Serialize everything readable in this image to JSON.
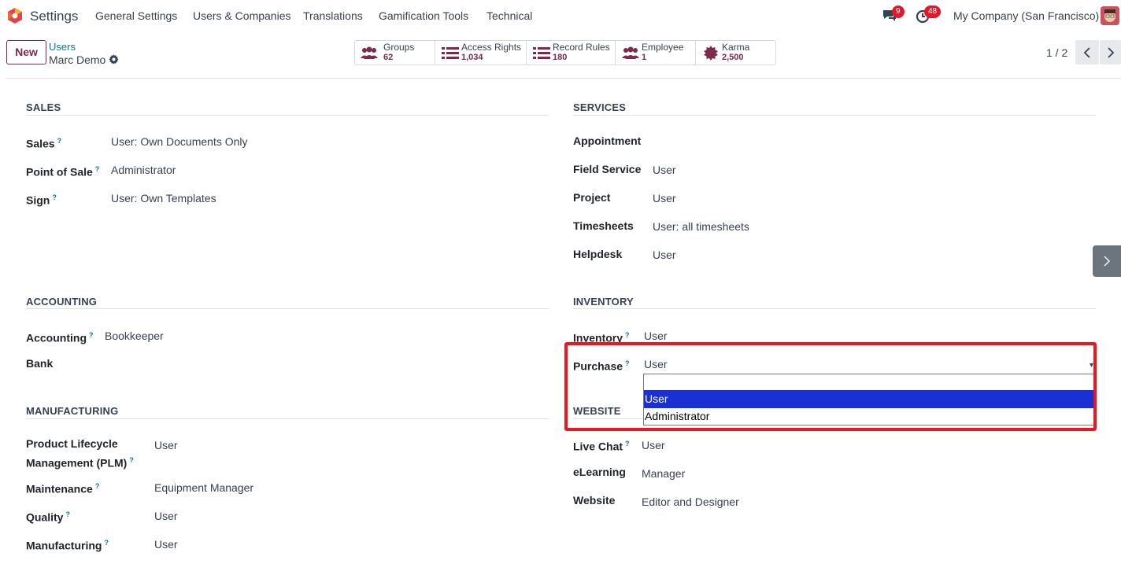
{
  "navbar": {
    "app_name": "Settings",
    "menus": [
      "General Settings",
      "Users & Companies",
      "Translations",
      "Gamification Tools",
      "Technical"
    ],
    "messages_badge": "9",
    "activities_badge": "48",
    "company": "My Company (San Francisco)"
  },
  "control": {
    "new_label": "New",
    "breadcrumb_parent": "Users",
    "breadcrumb_current": "Marc Demo",
    "pager": "1 / 2"
  },
  "smart_buttons": [
    {
      "label": "Groups",
      "value": "62",
      "icon": "users-icon"
    },
    {
      "label": "Access Rights",
      "value": "1,034",
      "icon": "list-icon"
    },
    {
      "label": "Record Rules",
      "value": "180",
      "icon": "list-icon"
    },
    {
      "label": "Employee",
      "value": "1",
      "icon": "users-icon"
    },
    {
      "label": "Karma",
      "value": "2,500",
      "icon": "badge-icon"
    }
  ],
  "sections": {
    "sales": {
      "title": "SALES",
      "fields": [
        {
          "label": "Sales",
          "value": "User: Own Documents Only"
        },
        {
          "label": "Point of Sale",
          "value": "Administrator"
        },
        {
          "label": "Sign",
          "value": "User: Own Templates"
        }
      ]
    },
    "services": {
      "title": "SERVICES",
      "fields": [
        {
          "label": "Appointment",
          "value": ""
        },
        {
          "label": "Field Service",
          "value": "User"
        },
        {
          "label": "Project",
          "value": "User"
        },
        {
          "label": "Timesheets",
          "value": "User: all timesheets"
        },
        {
          "label": "Helpdesk",
          "value": "User"
        }
      ]
    },
    "accounting": {
      "title": "ACCOUNTING",
      "fields": [
        {
          "label": "Accounting",
          "value": "Bookkeeper"
        },
        {
          "label": "Bank",
          "value": ""
        }
      ]
    },
    "inventory": {
      "title": "INVENTORY",
      "fields": [
        {
          "label": "Inventory",
          "value": "User"
        },
        {
          "label": "Purchase",
          "value": "User"
        }
      ]
    },
    "manufacturing": {
      "title": "MANUFACTURING",
      "fields": [
        {
          "label": "Product Lifecycle",
          "label2": "Management (PLM)",
          "value": "User"
        },
        {
          "label": "Maintenance",
          "value": "Equipment Manager"
        },
        {
          "label": "Quality",
          "value": "User"
        },
        {
          "label": "Manufacturing",
          "value": "User"
        }
      ]
    },
    "website": {
      "title": "WEBSITE",
      "fields": [
        {
          "label": "Live Chat",
          "value": "User"
        },
        {
          "label": "eLearning",
          "value": "Manager"
        },
        {
          "label": "Website",
          "value": "Editor and Designer"
        }
      ]
    }
  },
  "purchase_dropdown": {
    "options": [
      "",
      "User",
      "Administrator"
    ],
    "selected": "User"
  },
  "help_mark": "?",
  "colors": {
    "brand": "#7c2a4e",
    "link": "#017e84",
    "highlight": "#f0141e",
    "selected_option": "#1a2fd4"
  }
}
